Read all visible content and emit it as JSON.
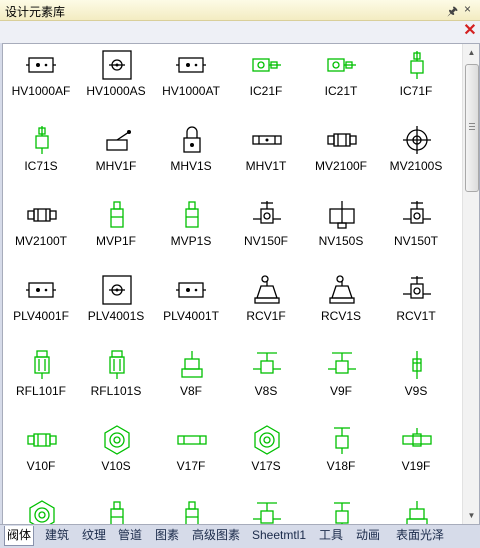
{
  "window": {
    "title": "设计元素库"
  },
  "icons": {
    "pin": "pin-icon",
    "close": "close-icon"
  },
  "colors": {
    "symbol_green": "#00c000",
    "symbol_black": "#000000",
    "close_red": "#d42020"
  },
  "items": [
    {
      "label": "HV1000AF",
      "kind": "box",
      "color": "black"
    },
    {
      "label": "HV1000AS",
      "kind": "box-center",
      "color": "black"
    },
    {
      "label": "HV1000AT",
      "kind": "box",
      "color": "black"
    },
    {
      "label": "IC21F",
      "kind": "ic",
      "color": "green"
    },
    {
      "label": "IC21T",
      "kind": "ic",
      "color": "green"
    },
    {
      "label": "IC71F",
      "kind": "ic-up",
      "color": "green"
    },
    {
      "label": "IC71S",
      "kind": "ic-up",
      "color": "green"
    },
    {
      "label": "MHV1F",
      "kind": "handle",
      "color": "black"
    },
    {
      "label": "MHV1S",
      "kind": "lock",
      "color": "black"
    },
    {
      "label": "MHV1T",
      "kind": "bar",
      "color": "black"
    },
    {
      "label": "MV2100F",
      "kind": "coupling",
      "color": "black"
    },
    {
      "label": "MV2100S",
      "kind": "cross-circle",
      "color": "black"
    },
    {
      "label": "MV2100T",
      "kind": "coupling",
      "color": "black"
    },
    {
      "label": "MVP1F",
      "kind": "vert",
      "color": "green"
    },
    {
      "label": "MVP1S",
      "kind": "vert",
      "color": "green"
    },
    {
      "label": "NV150F",
      "kind": "needle",
      "color": "black"
    },
    {
      "label": "NV150S",
      "kind": "needle-wide",
      "color": "black"
    },
    {
      "label": "NV150T",
      "kind": "needle",
      "color": "black"
    },
    {
      "label": "PLV4001F",
      "kind": "box",
      "color": "black"
    },
    {
      "label": "PLV4001S",
      "kind": "box-center",
      "color": "black"
    },
    {
      "label": "PLV4001T",
      "kind": "box",
      "color": "black"
    },
    {
      "label": "RCV1F",
      "kind": "regulator",
      "color": "black"
    },
    {
      "label": "RCV1S",
      "kind": "regulator",
      "color": "black"
    },
    {
      "label": "RCV1T",
      "kind": "needle",
      "color": "black"
    },
    {
      "label": "RFL101F",
      "kind": "filter",
      "color": "green"
    },
    {
      "label": "RFL101S",
      "kind": "filter",
      "color": "green"
    },
    {
      "label": "V8F",
      "kind": "v8",
      "color": "green"
    },
    {
      "label": "V8S",
      "kind": "handwheel",
      "color": "green"
    },
    {
      "label": "V9F",
      "kind": "handwheel",
      "color": "green"
    },
    {
      "label": "V9S",
      "kind": "needle-thin",
      "color": "green"
    },
    {
      "label": "V10F",
      "kind": "coupling",
      "color": "green"
    },
    {
      "label": "V10S",
      "kind": "hex",
      "color": "green"
    },
    {
      "label": "V17F",
      "kind": "pipe",
      "color": "green"
    },
    {
      "label": "V17S",
      "kind": "hex",
      "color": "green"
    },
    {
      "label": "V18F",
      "kind": "t-handle",
      "color": "green"
    },
    {
      "label": "V19F",
      "kind": "pipe-valve",
      "color": "green"
    },
    {
      "label": "",
      "kind": "hex",
      "color": "green"
    },
    {
      "label": "",
      "kind": "vert",
      "color": "green"
    },
    {
      "label": "",
      "kind": "vert",
      "color": "green"
    },
    {
      "label": "",
      "kind": "handwheel",
      "color": "green"
    },
    {
      "label": "",
      "kind": "t-handle",
      "color": "green"
    },
    {
      "label": "",
      "kind": "v8",
      "color": "green"
    }
  ],
  "tabs": [
    {
      "label": "阀体",
      "active": true
    },
    {
      "label": "建筑",
      "active": false
    },
    {
      "label": "纹理",
      "active": false
    },
    {
      "label": "管道",
      "active": false
    },
    {
      "label": "图素",
      "active": false
    },
    {
      "label": "高级图素",
      "active": false
    },
    {
      "label": "Sheetmtl1",
      "active": false
    },
    {
      "label": "工具",
      "active": false
    },
    {
      "label": "动画",
      "active": false
    },
    {
      "label": "表面光泽",
      "active": false
    }
  ]
}
